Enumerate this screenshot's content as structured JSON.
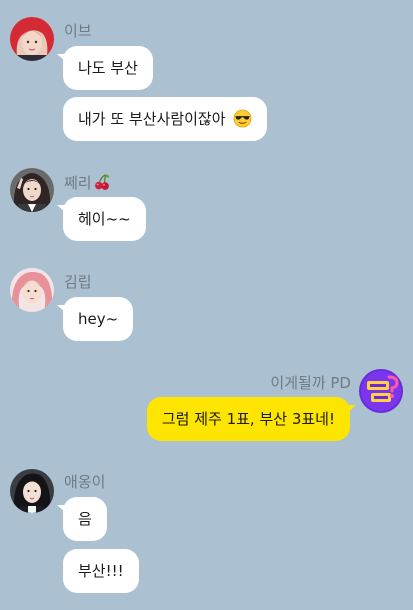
{
  "chat": {
    "background_color": "#abc1d1",
    "outgoing_bubble_color": "#fee500",
    "incoming_bubble_color": "#ffffff",
    "groups": [
      {
        "sender": "이브",
        "avatar": "profile-photo-red-hair",
        "messages": [
          "나도 부산",
          "내가 또 부산사람이잖아"
        ],
        "emoji": "sunglasses-emoji"
      },
      {
        "sender": "쩨리",
        "sender_emoji": "cherry-emoji",
        "avatar": "profile-photo-dark-hair",
        "messages": [
          "헤이~~"
        ]
      },
      {
        "sender": "김립",
        "avatar": "profile-photo-pink-hair",
        "messages": [
          "hey~"
        ]
      },
      {
        "sender": "이게될까 PD",
        "avatar": "channel-logo-purple",
        "messages": [
          "그럼 제주 1표, 부산 3표네!"
        ]
      },
      {
        "sender": "애옹이",
        "avatar": "profile-photo-black-hair",
        "messages": [
          "음",
          "부산!!!"
        ]
      }
    ]
  }
}
